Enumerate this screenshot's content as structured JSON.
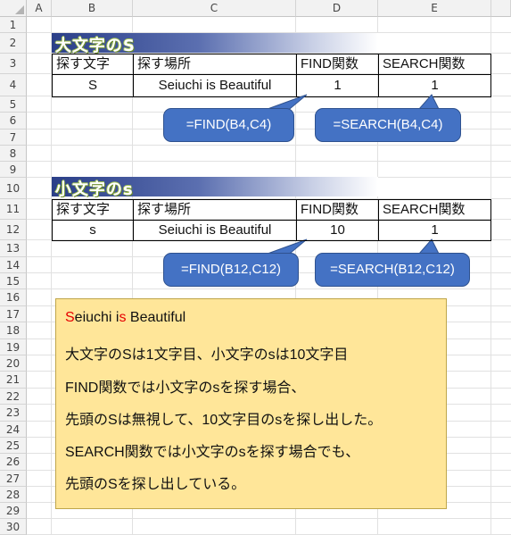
{
  "columns": [
    "A",
    "B",
    "C",
    "D",
    "E"
  ],
  "rows": [
    "1",
    "2",
    "3",
    "4",
    "5",
    "6",
    "7",
    "8",
    "9",
    "10",
    "11",
    "12",
    "13",
    "14",
    "15",
    "16",
    "17",
    "18",
    "19",
    "20",
    "21",
    "22",
    "23",
    "24",
    "25",
    "26",
    "27",
    "28",
    "29",
    "30"
  ],
  "section1": {
    "title": "大文字のS",
    "headers": [
      "探す文字",
      "探す場所",
      "FIND関数",
      "SEARCH関数"
    ],
    "values": [
      "S",
      "Seiuchi is Beautiful",
      "1",
      "1"
    ],
    "callout_find": "=FIND(B4,C4)",
    "callout_search": "=SEARCH(B4,C4)"
  },
  "section2": {
    "title": "小文字のs",
    "headers": [
      "探す文字",
      "探す場所",
      "FIND関数",
      "SEARCH関数"
    ],
    "values": [
      "s",
      "Seiuchi is Beautiful",
      "10",
      "1"
    ],
    "callout_find": "=FIND(B12,C12)",
    "callout_search": "=SEARCH(B12,C12)"
  },
  "note": {
    "line1_parts": [
      "S",
      "eiuchi i",
      "s",
      " Beautiful"
    ],
    "line2": "大文字のSは1文字目、小文字のsは10文字目",
    "line3": "FIND関数では小文字のsを探す場合、",
    "line4": "先頭のSは無視して、10文字目のsを探し出した。",
    "line5": "SEARCH関数では小文字のsを探す場合でも、",
    "line6": "先頭のSを探し出している。"
  },
  "colors": {
    "callout_fill": "#4472c4",
    "note_fill": "#ffe699",
    "highlight_red": "#e60000",
    "title_band": "#2b3f88"
  }
}
